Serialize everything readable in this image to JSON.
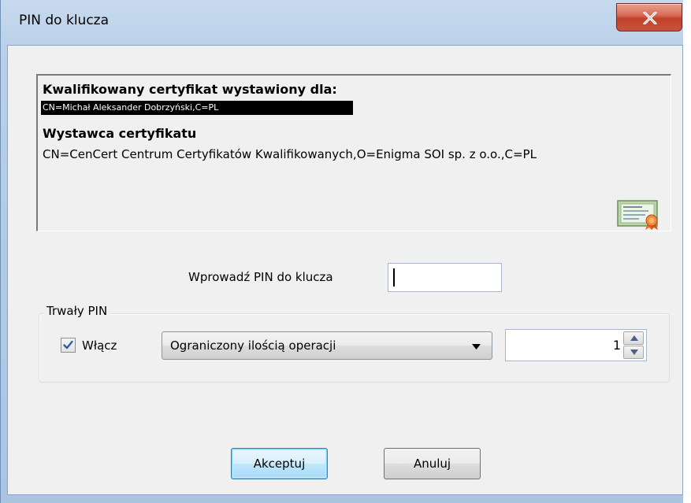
{
  "window": {
    "title": "PIN do klucza",
    "close_glyph": "X"
  },
  "certificate": {
    "subject_heading": "Kwalifikowany certyfikat wystawiony dla:",
    "subject_value": "CN=Michał Aleksander Dobrzyński,C=PL",
    "issuer_heading": "Wystawca certyfikatu",
    "issuer_value": "CN=CenCert Centrum Certyfikatów Kwalifikowanych,O=Enigma SOI sp. z o.o.,C=PL",
    "icon": "certificate-icon"
  },
  "pin": {
    "label": "Wprowadź PIN do klucza",
    "value": ""
  },
  "persistent_pin": {
    "group_title": "Trwały PIN",
    "enable_label": "Włącz",
    "enabled": true,
    "mode_selected": "Ograniczony ilością operacji",
    "count": "1"
  },
  "buttons": {
    "accept": "Akceptuj",
    "cancel": "Anuluj"
  },
  "colors": {
    "titlebar": "#b9cfe8",
    "close_button": "#c9533c",
    "dialog_bg": "#f0f0f0",
    "default_button": "#bee6fd"
  }
}
